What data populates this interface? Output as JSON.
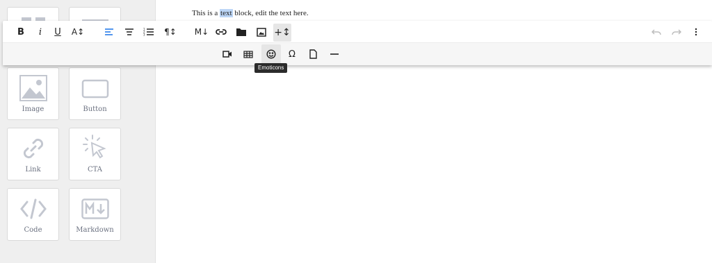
{
  "sidebar": {
    "tiles": [
      {
        "label": "Image",
        "icon": "image-icon"
      },
      {
        "label": "Button",
        "icon": "button-icon"
      },
      {
        "label": "Link",
        "icon": "link-icon"
      },
      {
        "label": "CTA",
        "icon": "cta-cursor-icon"
      },
      {
        "label": "Code",
        "icon": "code-icon"
      },
      {
        "label": "Markdown",
        "icon": "markdown-icon"
      }
    ]
  },
  "editor": {
    "text_before": "This is a ",
    "text_selected": "text",
    "text_after": " block, edit the text here."
  },
  "toolbar": {
    "bold": "B",
    "italic": "i",
    "underline": "U",
    "font_size": "A↕",
    "paragraph": "¶↕",
    "markdown": "M↓",
    "more_insert": "+↕",
    "special_char": "Ω",
    "tooltip": "Emoticons"
  },
  "colors": {
    "accent": "#1a73e8",
    "selection": "#bcd6f7",
    "icon_gray": "#c3c7d0"
  }
}
